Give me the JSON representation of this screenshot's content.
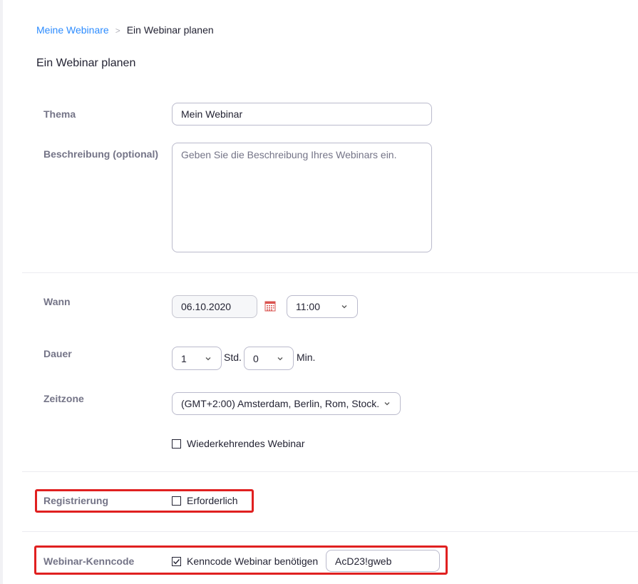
{
  "breadcrumb": {
    "parent": "Meine Webinare",
    "separator": ">",
    "current": "Ein Webinar planen"
  },
  "page_title": "Ein Webinar planen",
  "form": {
    "topic": {
      "label": "Thema",
      "value": "Mein Webinar"
    },
    "description": {
      "label": "Beschreibung (optional)",
      "placeholder": "Geben Sie die Beschreibung Ihres Webinars ein."
    },
    "when": {
      "label": "Wann",
      "date": "06.10.2020",
      "time": "11:00"
    },
    "duration": {
      "label": "Dauer",
      "hours": "1",
      "hours_unit": "Std.",
      "minutes": "0",
      "minutes_unit": "Min."
    },
    "timezone": {
      "label": "Zeitzone",
      "value": "(GMT+2:00) Amsterdam, Berlin, Rom, Stock..."
    },
    "recurring": {
      "label": "Wiederkehrendes Webinar",
      "checked": false
    },
    "registration": {
      "label": "Registrierung",
      "checkbox_label": "Erforderlich",
      "checked": false
    },
    "passcode": {
      "label": "Webinar-Kenncode",
      "checkbox_label": "Kenncode Webinar benötigen",
      "checked": true,
      "value": "AcD23!gweb"
    }
  },
  "colors": {
    "link": "#2d8cff",
    "highlight": "#e02020",
    "label": "#747487"
  }
}
